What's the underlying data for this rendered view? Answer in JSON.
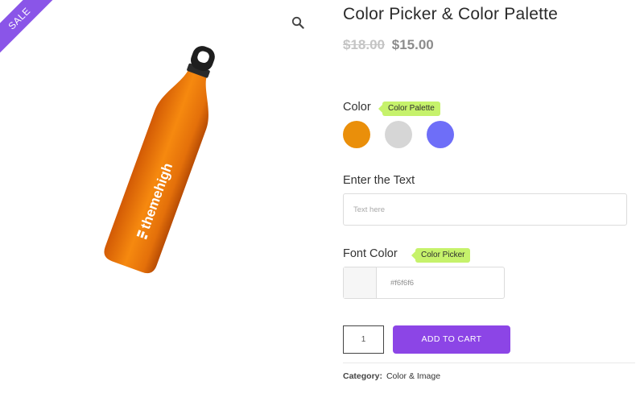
{
  "badge": {
    "sale": "SALE"
  },
  "icons": {
    "zoom": "magnifier-icon",
    "logo": "themehigh-logo"
  },
  "product": {
    "title": "Color Picker & Color Palette",
    "price_old": "$18.00",
    "price_new": "$15.00",
    "bottle_text": "themehigh"
  },
  "fields": {
    "color": {
      "label": "Color",
      "tooltip": "Color Palette",
      "swatches": [
        "#ea8f0a",
        "#d6d6d6",
        "#6e6ef8"
      ]
    },
    "text": {
      "label": "Enter the Text",
      "placeholder": "Text here"
    },
    "font_color": {
      "label": "Font Color",
      "tooltip": "Color Picker",
      "value": "#f6f6f6"
    }
  },
  "cart": {
    "quantity": "1",
    "button_label": "ADD TO CART"
  },
  "meta": {
    "category_label": "Category:",
    "category_value": "Color & Image"
  },
  "colors": {
    "sale_ribbon": "#8a55e8",
    "accent_button": "#8c45e6",
    "tooltip": "#c6f26b"
  }
}
